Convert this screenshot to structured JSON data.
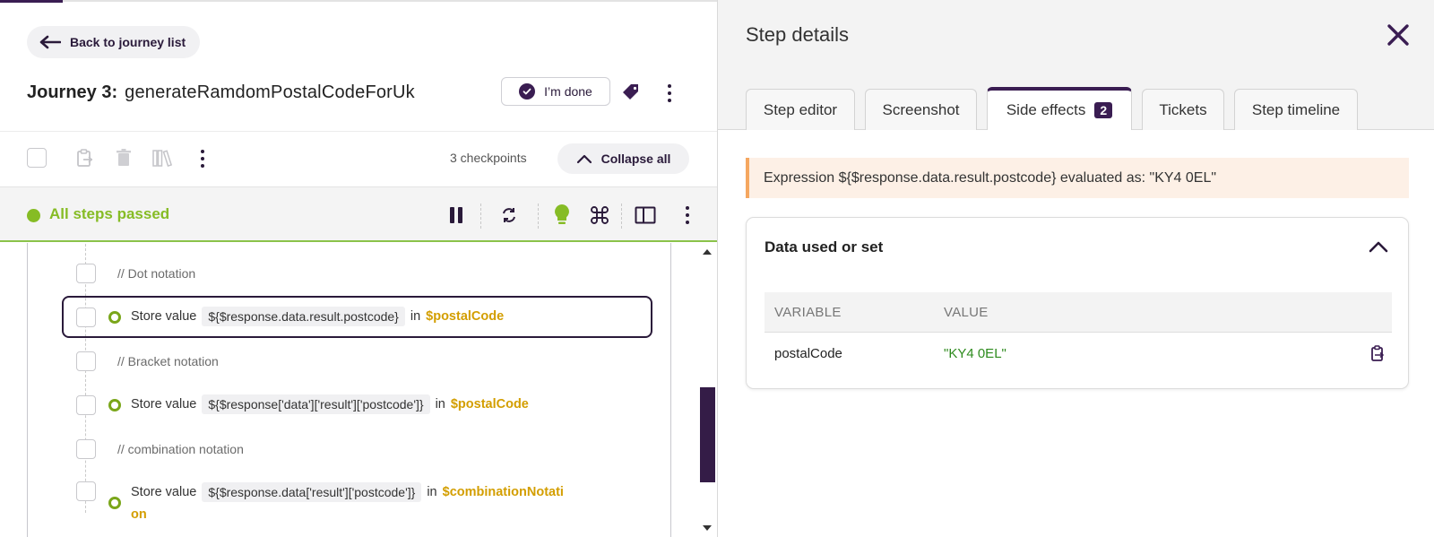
{
  "left_panel": {
    "back_label": "Back to journey list",
    "journey": {
      "prefix": "Journey 3:",
      "name": "generateRamdomPostalCodeForUk"
    },
    "done_label": "I’m done",
    "checkpoints_label": "3 checkpoints",
    "collapse_label": "Collapse all",
    "status_text": "All steps passed",
    "steps": [
      {
        "comment": "// Dot notation"
      },
      {
        "action": "Store value",
        "expression": "${$response.data.result.postcode}",
        "connector": "in",
        "variable": "$postalCode",
        "selected": true
      },
      {
        "comment": "// Bracket notation"
      },
      {
        "action": "Store value",
        "expression": "${$response['data']['result']['postcode']}",
        "connector": "in",
        "variable": "$postalCode"
      },
      {
        "comment": "// combination notation"
      },
      {
        "action": "Store value",
        "expression": "${$response.data['result']['postcode']}",
        "connector": "in",
        "variable_line1": "$combinationNotati",
        "variable_line2": "on"
      }
    ]
  },
  "right_panel": {
    "title": "Step details",
    "tabs": [
      {
        "label": "Step editor"
      },
      {
        "label": "Screenshot"
      },
      {
        "label": "Side effects",
        "badge": "2",
        "active": true
      },
      {
        "label": "Tickets"
      },
      {
        "label": "Step timeline"
      }
    ],
    "alert_text": "Expression ${$response.data.result.postcode} evaluated as: \"KY4 0EL\"",
    "card": {
      "title": "Data used or set",
      "columns": [
        "VARIABLE",
        "VALUE"
      ],
      "rows": [
        {
          "variable": "postalCode",
          "value": "\"KY4 0EL\""
        }
      ]
    }
  },
  "colors": {
    "brand": "#3a1d52",
    "success": "#86bc25",
    "variable": "#d39e00",
    "value_green": "#2e8b1e",
    "alert_border": "#f5a760"
  }
}
